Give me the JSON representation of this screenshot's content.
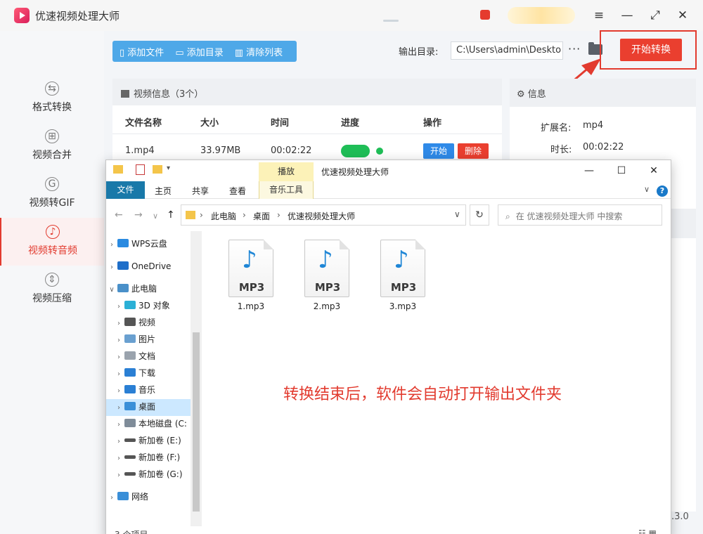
{
  "app": {
    "title": "优速视频处理大师",
    "version": ".3.0"
  },
  "window_controls": {
    "menu": "≡",
    "minimize": "—",
    "maximize": "⤢",
    "close": "✕"
  },
  "sidebar": {
    "items": [
      {
        "label": "格式转换",
        "icon": "⇆"
      },
      {
        "label": "视频合并",
        "icon": "⊞"
      },
      {
        "label": "视频转GIF",
        "icon": "G"
      },
      {
        "label": "视频转音频",
        "icon": "♪"
      },
      {
        "label": "视频压缩",
        "icon": "⇕"
      }
    ],
    "active_index": 3
  },
  "toolbar": {
    "add_file": "添加文件",
    "add_dir": "添加目录",
    "clear_list": "清除列表",
    "output_label": "输出目录:",
    "output_path": "C:\\Users\\admin\\Deskto",
    "more": "···",
    "start_label": "开始转换"
  },
  "video_panel": {
    "title": "视频信息（3个）",
    "columns": [
      "文件名称",
      "大小",
      "时间",
      "进度",
      "操作"
    ],
    "rows": [
      {
        "name": "1.mp4",
        "size": "33.97MB",
        "time": "00:02:22",
        "progress": 1.0,
        "start": "开始",
        "delete": "删除"
      }
    ]
  },
  "info_panel": {
    "title": "信息",
    "ext_label": "扩展名:",
    "ext_value": "mp4",
    "dur_label": "时长:",
    "dur_value": "00:02:22"
  },
  "explorer": {
    "title": "优速视频处理大师",
    "context_tab": "播放",
    "ribbon_tabs": [
      "文件",
      "主页",
      "共享",
      "查看",
      "音乐工具"
    ],
    "breadcrumb": [
      "此电脑",
      "桌面",
      "优速视频处理大师"
    ],
    "search_placeholder": "在 优速视频处理大师 中搜索",
    "tree": [
      {
        "label": "WPS云盘",
        "color": "#2a8ae0"
      },
      {
        "label": "OneDrive",
        "color": "#1f6fc9"
      },
      {
        "label": "此电脑",
        "color": "#4a90c9"
      },
      {
        "label": "3D 对象",
        "color": "#2bb0d6"
      },
      {
        "label": "视频",
        "color": "#555555"
      },
      {
        "label": "图片",
        "color": "#6aa0d0"
      },
      {
        "label": "文档",
        "color": "#9aa3ad"
      },
      {
        "label": "下载",
        "color": "#2a7fd4"
      },
      {
        "label": "音乐",
        "color": "#2a7fd4"
      },
      {
        "label": "桌面",
        "color": "#3a8fd8"
      },
      {
        "label": "本地磁盘 (C:",
        "color": "#7f8c99"
      },
      {
        "label": "新加卷 (E:)",
        "color": "#555555"
      },
      {
        "label": "新加卷 (F:)",
        "color": "#555555"
      },
      {
        "label": "新加卷 (G:)",
        "color": "#555555"
      },
      {
        "label": "网络",
        "color": "#3a8fd8"
      }
    ],
    "selected_tree": "桌面",
    "files": [
      {
        "name": "1.mp3",
        "tag": "MP3"
      },
      {
        "name": "2.mp3",
        "tag": "MP3"
      },
      {
        "name": "3.mp3",
        "tag": "MP3"
      }
    ],
    "annotation": "转换结束后，软件会自动打开输出文件夹",
    "status_count": "3 个项目"
  },
  "colors": {
    "accent": "#ea3f2f",
    "blue": "#4ea8e8",
    "ribbon_file": "#1979a9",
    "progress": "#1fbe57"
  }
}
